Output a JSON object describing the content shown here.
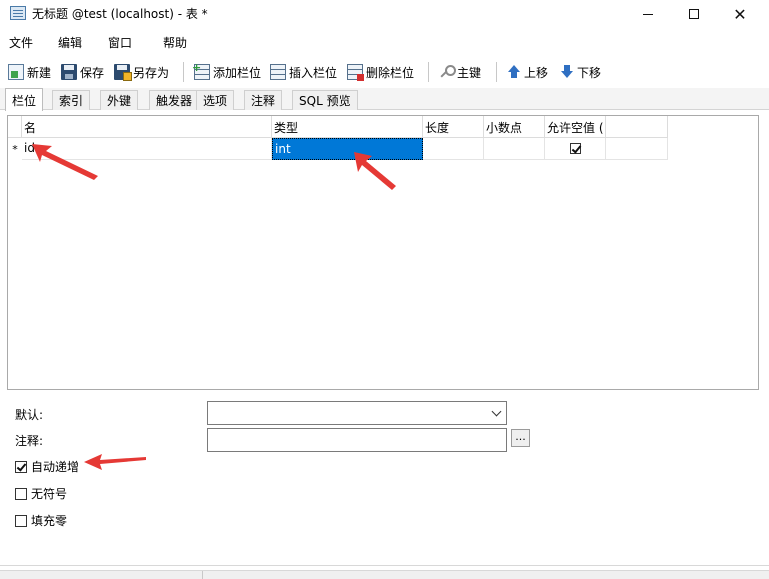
{
  "window": {
    "title": "无标题 @test (localhost) - 表 *",
    "minimize": "",
    "maximize": "",
    "close": "✕"
  },
  "menu": {
    "items": [
      "文件",
      "编辑",
      "窗口",
      "帮助"
    ]
  },
  "toolbar": {
    "new_label": "新建",
    "save_label": "保存",
    "saveas_label": "另存为",
    "add_field_label": "添加栏位",
    "insert_field_label": "插入栏位",
    "delete_field_label": "删除栏位",
    "primary_key_label": "主键",
    "move_up_label": "上移",
    "move_down_label": "下移"
  },
  "tabs": [
    "栏位",
    "索引",
    "外键",
    "触发器",
    "选项",
    "注释",
    "SQL 预览"
  ],
  "active_tab": "栏位",
  "grid": {
    "columns": [
      "名",
      "类型",
      "长度",
      "小数点",
      "允许空值 ("
    ],
    "rows": [
      {
        "marker": "*",
        "name": "id",
        "type": "int",
        "length": "",
        "decimals": "",
        "allow_null": true
      }
    ]
  },
  "properties": {
    "default_label": "默认:",
    "default_value": "",
    "comment_label": "注释:",
    "comment_value": "",
    "ellipsis_label": "...",
    "auto_increment_label": "自动递增",
    "auto_increment_checked": true,
    "unsigned_label": "无符号",
    "unsigned_checked": false,
    "zerofill_label": "填充零",
    "zerofill_checked": false
  },
  "colors": {
    "selection": "#0078d7",
    "annotation_arrow": "#e53935",
    "icon_blue": "#2f6fc2"
  }
}
